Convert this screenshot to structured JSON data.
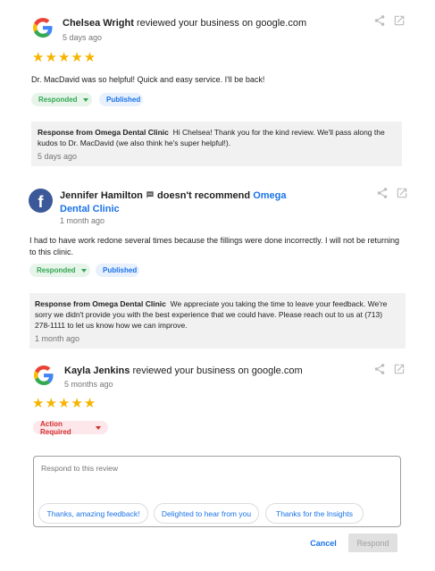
{
  "reviews": [
    {
      "source": "google",
      "reviewer": "Chelsea Wright",
      "action": "reviewed your business on google.com",
      "time": "5 days ago",
      "rating": 5,
      "text": "Dr. MacDavid was so helpful! Quick and easy service. I'll be back!",
      "status_chip": "Responded",
      "publish_chip": "Published",
      "response_label": "Response from Omega Dental Clinic",
      "response_text": "Hi Chelsea! Thank you for the kind review. We'll pass along the kudos to Dr. MacDavid (we also think he's super helpful!).",
      "response_time": "5 days ago"
    },
    {
      "source": "facebook",
      "reviewer": "Jennifer Hamilton",
      "action": "doesn't recommend",
      "business": "Omega Dental Clinic",
      "time": "1 month ago",
      "text": "I had to have work redone several times because the fillings were done incorrectly. I will not be returning to this clinic.",
      "status_chip": "Responded",
      "publish_chip": "Published",
      "response_label": "Response from Omega Dental Clinic",
      "response_text": "We appreciate you taking the time to leave your feedback. We're sorry we didn't provide you with the best experience that we could have. Please reach out to us at (713) 278-1111 to let us know how we can improve.",
      "response_time": "1 month ago"
    },
    {
      "source": "google",
      "reviewer": "Kayla Jenkins",
      "action": "reviewed your business on google.com",
      "time": "5 months ago",
      "rating": 5,
      "status_chip": "Action Required"
    }
  ],
  "reply_box": {
    "placeholder": "Respond to this review",
    "suggestions": [
      "Thanks, amazing feedback!",
      "Delighted to hear from you",
      "Thanks for the Insights"
    ],
    "cancel_label": "Cancel",
    "respond_label": "Respond"
  },
  "colors": {
    "stars": "#f4b400",
    "accent_blue": "#1a73e8",
    "facebook": "#3b5998",
    "responded_green": "#34a853",
    "action_red": "#d32f2f"
  }
}
